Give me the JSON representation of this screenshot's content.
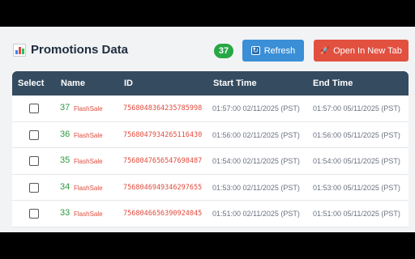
{
  "header": {
    "title": "Promotions Data",
    "count": "37",
    "refresh_label": "Refresh",
    "open_tab_label": "Open In New Tab"
  },
  "table": {
    "columns": [
      "Select",
      "Name",
      "ID",
      "Start Time",
      "End Time"
    ],
    "rows": [
      {
        "num": "37",
        "tag": "FlashSale",
        "id": "7568048364235785998",
        "start": "01:57:00 02/11/2025 (PST)",
        "end": "01:57:00 05/11/2025 (PST)"
      },
      {
        "num": "36",
        "tag": "FlashSale",
        "id": "7568047934265116430",
        "start": "01:56:00 02/11/2025 (PST)",
        "end": "01:56:00 05/11/2025 (PST)"
      },
      {
        "num": "35",
        "tag": "FlashSale",
        "id": "7568047656547698487",
        "start": "01:54:00 02/11/2025 (PST)",
        "end": "01:54:00 05/11/2025 (PST)"
      },
      {
        "num": "34",
        "tag": "FlashSale",
        "id": "7568046949346297655",
        "start": "01:53:00 02/11/2025 (PST)",
        "end": "01:53:00 05/11/2025 (PST)"
      },
      {
        "num": "33",
        "tag": "FlashSale",
        "id": "7568046656390924045",
        "start": "01:51:00 02/11/2025 (PST)",
        "end": "01:51:00 05/11/2025 (PST)"
      }
    ]
  },
  "colors": {
    "header_bg": "#354b5f",
    "badge": "#27a745",
    "refresh": "#3a8fd6",
    "open_tab": "#e2503f",
    "number": "#2d9a3e",
    "id": "#e04b3d"
  },
  "icons": {
    "title": "bar-chart-icon",
    "refresh": "refresh-icon",
    "open_tab": "rocket-icon"
  }
}
